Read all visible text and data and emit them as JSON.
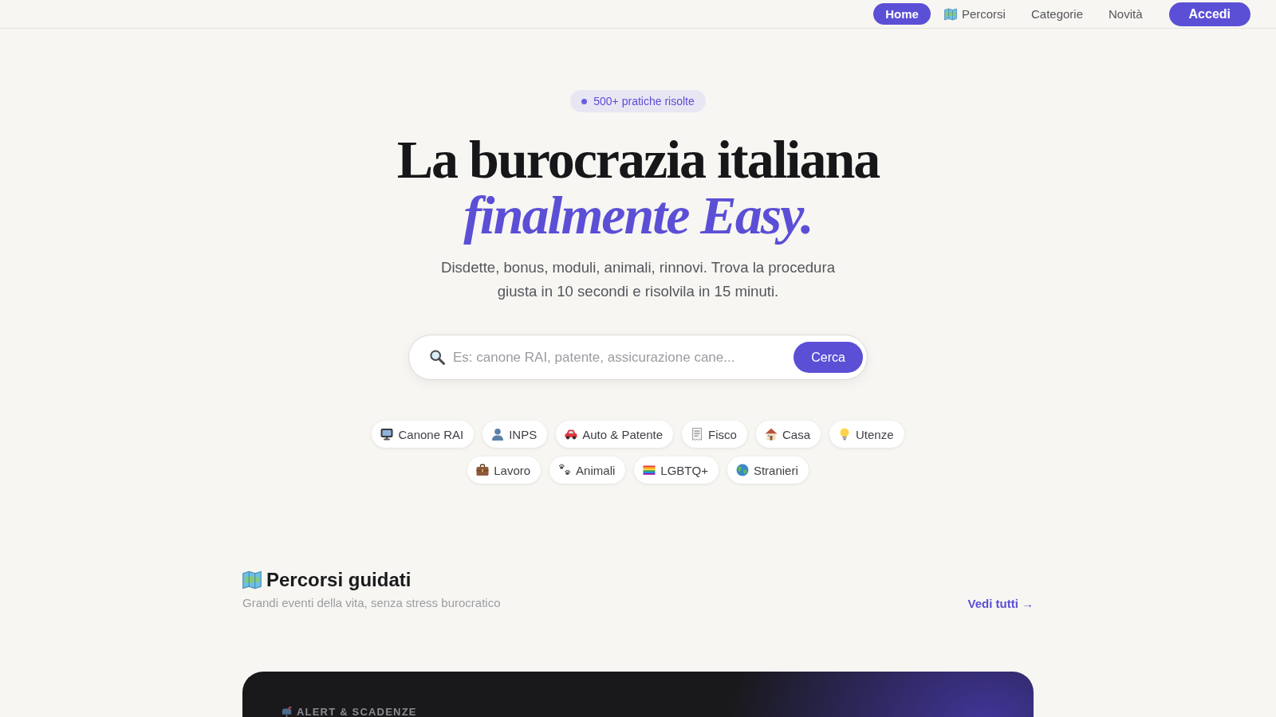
{
  "header": {
    "nav": [
      {
        "label": "Home",
        "selected": true
      },
      {
        "label": "Percorsi",
        "selected": false
      },
      {
        "label": "Categorie",
        "selected": false
      },
      {
        "label": "Novità",
        "selected": false
      }
    ],
    "login_button": "Accedi"
  },
  "hero": {
    "badge": "500+ pratiche risolte",
    "title_line_1": "La burocrazia italiana",
    "title_line_2": "finalmente Easy.",
    "subtitle": "Disdette, bonus, moduli, animali, rinnovi. Trova la procedura giusta in 10 secondi e risolvila in 15 minuti.",
    "search": {
      "placeholder": "Es: canone RAI, patente, assicurazione cane...",
      "button": "Cerca"
    },
    "categories": [
      {
        "label": "Canone RAI"
      },
      {
        "label": "INPS"
      },
      {
        "label": "Auto & Patente"
      },
      {
        "label": "Fisco"
      },
      {
        "label": "Casa"
      },
      {
        "label": "Utenze"
      },
      {
        "label": "Lavoro"
      },
      {
        "label": "Animali"
      },
      {
        "label": "LGBTQ+"
      },
      {
        "label": "Stranieri"
      }
    ]
  },
  "guided_paths": {
    "title": "Percorsi guidati",
    "subtitle": "Grandi eventi della vita, senza stress burocratico",
    "link": "Vedi tutti →"
  },
  "alert_card": {
    "label": "ALERT & SCADENZE"
  }
}
